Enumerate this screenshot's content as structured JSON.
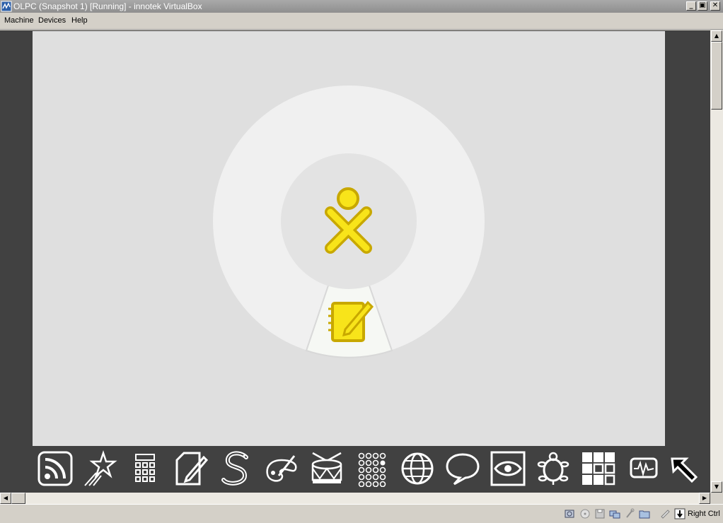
{
  "window": {
    "title": "OLPC (Snapshot 1) [Running] - innotek VirtualBox",
    "minimize_glyph": "_",
    "maximize_glyph": "▣",
    "close_glyph": "✕"
  },
  "menubar": {
    "items": [
      {
        "label": "Machine"
      },
      {
        "label": "Devices"
      },
      {
        "label": "Help"
      }
    ]
  },
  "sugar": {
    "home_view": "activity-ring",
    "xo_owner_icon": "xo-person-icon",
    "active_activity": "write-journal-icon",
    "colors": {
      "background": "#dfdfdf",
      "ring": "#f0f0f0",
      "xo_fill": "#f8e41a",
      "xo_stroke": "#c8a800",
      "frame": "#414141"
    }
  },
  "frame": {
    "activities": [
      {
        "name": "rss-feed-icon"
      },
      {
        "name": "shooting-star-icon"
      },
      {
        "name": "calculator-icon"
      },
      {
        "name": "write-icon"
      },
      {
        "name": "snake-icon"
      },
      {
        "name": "paint-icon"
      },
      {
        "name": "drum-icon"
      },
      {
        "name": "dots-grid-icon"
      },
      {
        "name": "browse-globe-icon"
      },
      {
        "name": "chat-bubble-icon"
      },
      {
        "name": "eye-icon"
      },
      {
        "name": "turtle-icon"
      },
      {
        "name": "blocks-grid-icon"
      },
      {
        "name": "measure-wave-icon"
      },
      {
        "name": "pointer-arrow-icon"
      }
    ]
  },
  "statusbar": {
    "host_key_label": "Right Ctrl",
    "icons": [
      "harddisk-icon",
      "cdrom-icon",
      "floppy-icon",
      "network-icon",
      "usb-icon",
      "shared-folder-icon",
      "mouse-integration-icon",
      "host-key-icon"
    ]
  }
}
